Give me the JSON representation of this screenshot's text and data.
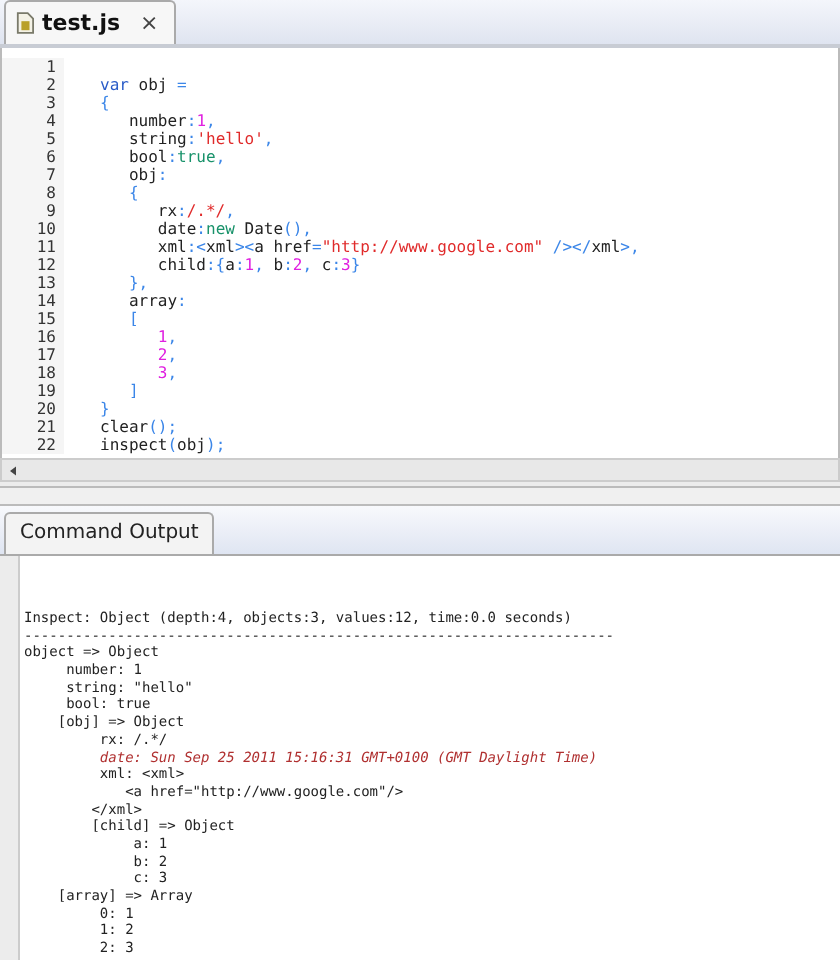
{
  "editor_tab": {
    "title": "test.js",
    "close": "×",
    "selected": true
  },
  "code": [
    {
      "number": "1"
    },
    {
      "number": "2",
      "tokens": [
        {
          "kind": "keyword",
          "text": "var"
        },
        {
          "kind": "text",
          "text": " obj "
        },
        {
          "kind": "punct",
          "text": "="
        }
      ]
    },
    {
      "number": "3",
      "tokens": [
        {
          "kind": "punct",
          "text": "{"
        }
      ]
    },
    {
      "number": "4",
      "tokens": [
        {
          "kind": "text",
          "text": "   number"
        },
        {
          "kind": "punct",
          "text": ":"
        },
        {
          "kind": "num",
          "text": "1"
        },
        {
          "kind": "punct",
          "text": ","
        }
      ]
    },
    {
      "number": "5",
      "tokens": [
        {
          "kind": "text",
          "text": "   string"
        },
        {
          "kind": "punct",
          "text": ":"
        },
        {
          "kind": "str",
          "text": "'hello'"
        },
        {
          "kind": "punct",
          "text": ","
        }
      ]
    },
    {
      "number": "6",
      "tokens": [
        {
          "kind": "text",
          "text": "   bool"
        },
        {
          "kind": "punct",
          "text": ":"
        },
        {
          "kind": "literal",
          "text": "true"
        },
        {
          "kind": "punct",
          "text": ","
        }
      ]
    },
    {
      "number": "7",
      "tokens": [
        {
          "kind": "text",
          "text": "   obj"
        },
        {
          "kind": "punct",
          "text": ":"
        }
      ]
    },
    {
      "number": "8",
      "tokens": [
        {
          "kind": "punct",
          "text": "   {"
        }
      ]
    },
    {
      "number": "9",
      "tokens": [
        {
          "kind": "text",
          "text": "      rx"
        },
        {
          "kind": "punct",
          "text": ":"
        },
        {
          "kind": "str",
          "text": "/.*/"
        },
        {
          "kind": "punct",
          "text": ","
        }
      ]
    },
    {
      "number": "10",
      "tokens": [
        {
          "kind": "text",
          "text": "      date"
        },
        {
          "kind": "punct",
          "text": ":"
        },
        {
          "kind": "literal",
          "text": "new"
        },
        {
          "kind": "text",
          "text": " Date"
        },
        {
          "kind": "punct",
          "text": "(),"
        }
      ]
    },
    {
      "number": "11",
      "tokens": [
        {
          "kind": "text",
          "text": "      xml"
        },
        {
          "kind": "punct",
          "text": ":<"
        },
        {
          "kind": "text",
          "text": "xml"
        },
        {
          "kind": "punct",
          "text": "><"
        },
        {
          "kind": "text",
          "text": "a href"
        },
        {
          "kind": "punct",
          "text": "="
        },
        {
          "kind": "str",
          "text": "\"http://www.google.com\""
        },
        {
          "kind": "punct",
          "text": " /></"
        },
        {
          "kind": "text",
          "text": "xml"
        },
        {
          "kind": "punct",
          "text": ">,"
        }
      ]
    },
    {
      "number": "12",
      "tokens": [
        {
          "kind": "text",
          "text": "      child"
        },
        {
          "kind": "punct",
          "text": ":{"
        },
        {
          "kind": "text",
          "text": "a"
        },
        {
          "kind": "punct",
          "text": ":"
        },
        {
          "kind": "num",
          "text": "1"
        },
        {
          "kind": "punct",
          "text": ", "
        },
        {
          "kind": "text",
          "text": "b"
        },
        {
          "kind": "punct",
          "text": ":"
        },
        {
          "kind": "num",
          "text": "2"
        },
        {
          "kind": "punct",
          "text": ", "
        },
        {
          "kind": "text",
          "text": "c"
        },
        {
          "kind": "punct",
          "text": ":"
        },
        {
          "kind": "num",
          "text": "3"
        },
        {
          "kind": "punct",
          "text": "}"
        }
      ]
    },
    {
      "number": "13",
      "tokens": [
        {
          "kind": "punct",
          "text": "   },"
        }
      ]
    },
    {
      "number": "14",
      "tokens": [
        {
          "kind": "text",
          "text": "   array"
        },
        {
          "kind": "punct",
          "text": ":"
        }
      ]
    },
    {
      "number": "15",
      "tokens": [
        {
          "kind": "punct",
          "text": "   ["
        }
      ]
    },
    {
      "number": "16",
      "tokens": [
        {
          "kind": "num",
          "text": "      1"
        },
        {
          "kind": "punct",
          "text": ","
        }
      ]
    },
    {
      "number": "17",
      "tokens": [
        {
          "kind": "num",
          "text": "      2"
        },
        {
          "kind": "punct",
          "text": ","
        }
      ]
    },
    {
      "number": "18",
      "tokens": [
        {
          "kind": "num",
          "text": "      3"
        },
        {
          "kind": "punct",
          "text": ","
        }
      ]
    },
    {
      "number": "19",
      "tokens": [
        {
          "kind": "punct",
          "text": "   ]"
        }
      ]
    },
    {
      "number": "20",
      "tokens": [
        {
          "kind": "punct",
          "text": "}"
        }
      ]
    },
    {
      "number": "21",
      "tokens": [
        {
          "kind": "text",
          "text": "clear"
        },
        {
          "kind": "punct",
          "text": "();"
        }
      ]
    },
    {
      "number": "22",
      "tokens": [
        {
          "kind": "text",
          "text": "inspect"
        },
        {
          "kind": "punct",
          "text": "("
        },
        {
          "kind": "text",
          "text": "obj"
        },
        {
          "kind": "punct",
          "text": ");"
        }
      ]
    }
  ],
  "output_tab": {
    "title": "Command Output",
    "selected": true
  },
  "output": [
    {
      "kind": "text",
      "text": "Inspect: Object (depth:4, objects:3, values:12, time:0.0 seconds)"
    },
    {
      "kind": "text",
      "text": "----------------------------------------------------------------------"
    },
    {
      "kind": "text",
      "text": "object => Object"
    },
    {
      "kind": "text",
      "text": "     number: 1"
    },
    {
      "kind": "text",
      "text": "     string: \"hello\""
    },
    {
      "kind": "text",
      "text": "     bool: true"
    },
    {
      "kind": "text",
      "text": "    [obj] => Object"
    },
    {
      "kind": "text",
      "text": "         rx: /.*/"
    },
    {
      "kind": "date",
      "text": "         date: Sun Sep 25 2011 15:16:31 GMT+0100 (GMT Daylight Time)"
    },
    {
      "kind": "text",
      "text": "         xml: <xml>"
    },
    {
      "kind": "text",
      "text": "            <a href=\"http://www.google.com\"/>"
    },
    {
      "kind": "text",
      "text": "        </xml>"
    },
    {
      "kind": "text",
      "text": "        [child] => Object"
    },
    {
      "kind": "text",
      "text": "             a: 1"
    },
    {
      "kind": "text",
      "text": "             b: 2"
    },
    {
      "kind": "text",
      "text": "             c: 3"
    },
    {
      "kind": "text",
      "text": "    [array] => Array"
    },
    {
      "kind": "text",
      "text": "         0: 1"
    },
    {
      "kind": "text",
      "text": "         1: 2"
    },
    {
      "kind": "text",
      "text": "         2: 3"
    }
  ]
}
